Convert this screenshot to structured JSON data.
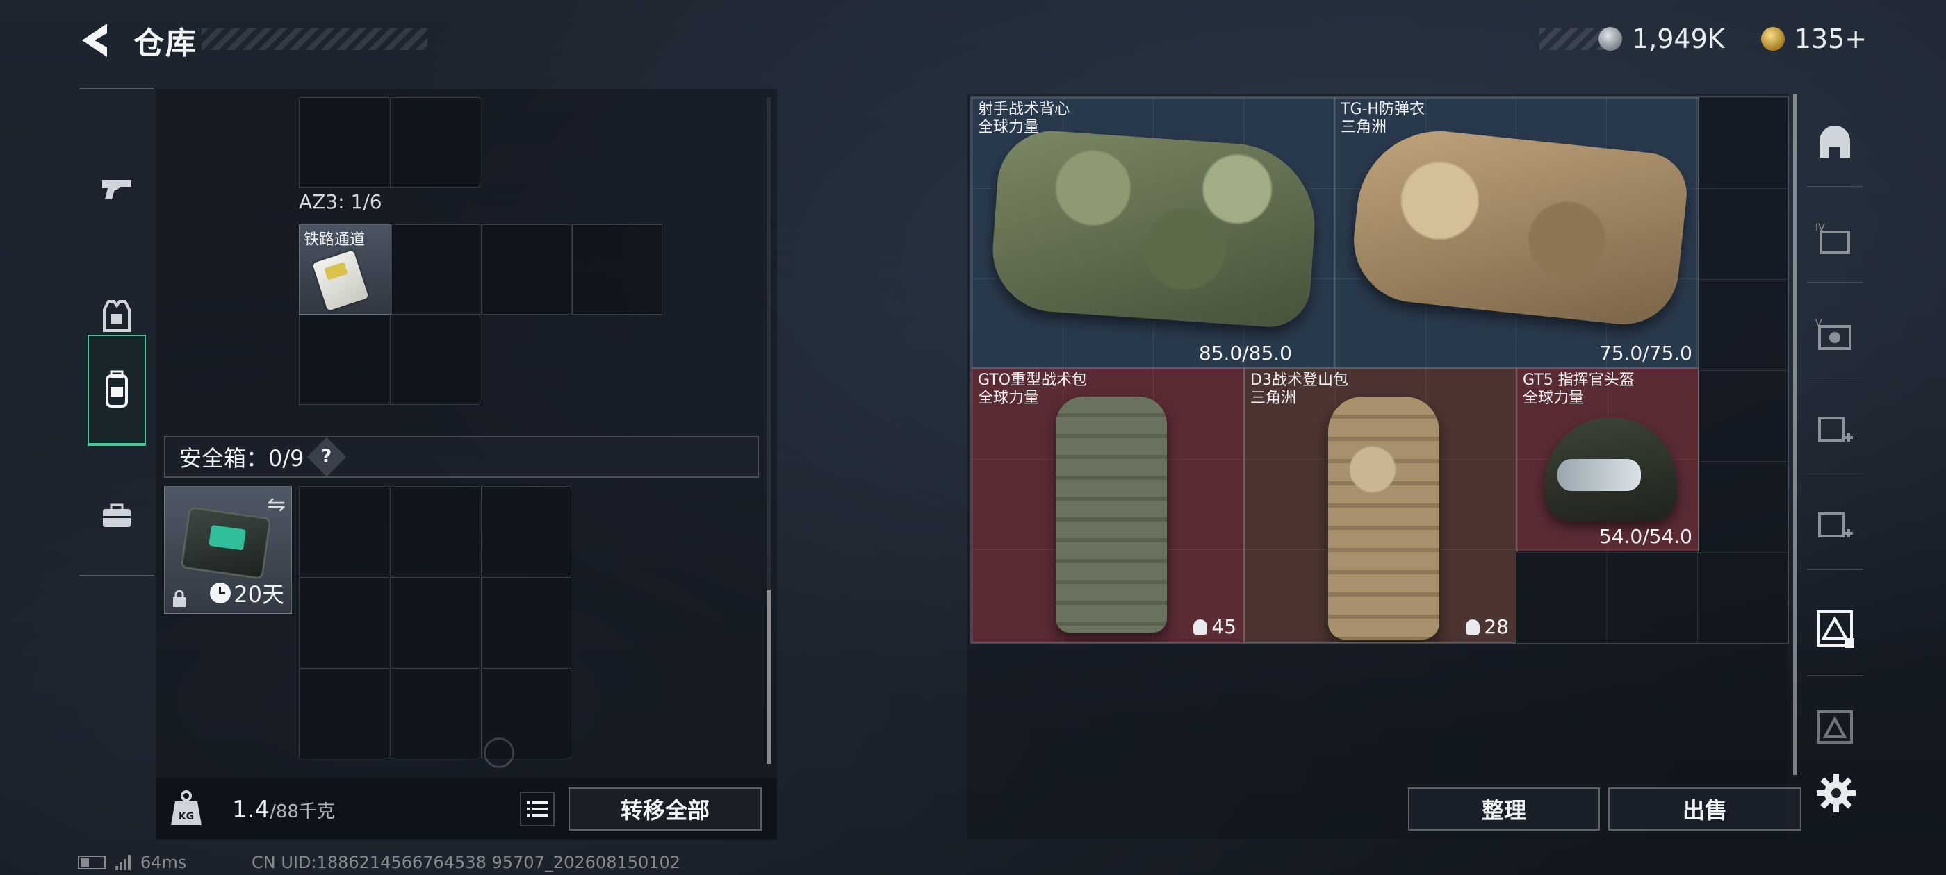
{
  "header": {
    "title": "仓库",
    "currencies": [
      {
        "icon": "silver-coin-icon",
        "value": "1,949K"
      },
      {
        "icon": "gold-coin-icon",
        "value": "135+"
      }
    ]
  },
  "sidebar": {
    "items": [
      {
        "name": "weapons",
        "icon": "pistol-icon",
        "active": false
      },
      {
        "name": "gear",
        "icon": "armor-vest-icon",
        "active": false
      },
      {
        "name": "backpack",
        "icon": "backpack-icon",
        "active": true
      },
      {
        "name": "toolbox",
        "icon": "briefcase-icon",
        "active": false
      }
    ]
  },
  "container": {
    "label": "AZ3: 1/6",
    "item": {
      "name": "铁路通道",
      "icon": "keycard-icon"
    }
  },
  "safebox": {
    "label": "安全箱：0/9",
    "help": "?",
    "days": "20天"
  },
  "bottom": {
    "weight": "1.4",
    "capacity": "/88千克",
    "transfer_all": "转移全部"
  },
  "equipment": [
    {
      "name": "射手战术背心",
      "brand": "全球力量",
      "durability": "85.0/85.0",
      "rarity": "blue"
    },
    {
      "name": "TG-H防弹衣",
      "brand": "三角洲",
      "durability": "75.0/75.0",
      "rarity": "blue"
    },
    {
      "name": "GTO重型战术包",
      "brand": "全球力量",
      "capacity": "45",
      "rarity": "red"
    },
    {
      "name": "D3战术登山包",
      "brand": "三角洲",
      "capacity": "28",
      "rarity": "brown"
    },
    {
      "name": "GT5 指挥官头盔",
      "brand": "全球力量",
      "durability": "54.0/54.0",
      "rarity": "red"
    }
  ],
  "actions": {
    "sort": "整理",
    "sell": "出售"
  },
  "status": {
    "ping": "64ms",
    "uid": "CN UID:1886214566764538 95707_202608150102"
  },
  "colors": {
    "accent": "#46c89b",
    "rarity_blue": "#2a3a4d",
    "rarity_red": "#5a2b33",
    "rarity_brown": "#4c3430"
  }
}
